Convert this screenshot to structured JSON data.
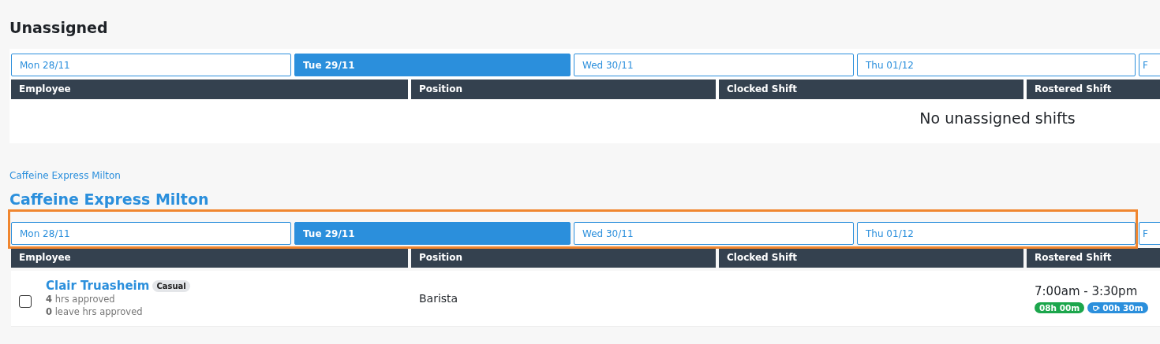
{
  "sections": [
    {
      "kind": "unassigned",
      "title": "Unassigned",
      "highlighted": false,
      "days": [
        {
          "label": "Mon 28/11",
          "selected": false
        },
        {
          "label": "Tue 29/11",
          "selected": true
        },
        {
          "label": "Wed 30/11",
          "selected": false
        },
        {
          "label": "Thu 01/12",
          "selected": false
        },
        {
          "label": "F",
          "selected": false
        }
      ],
      "columns": [
        "Employee",
        "Position",
        "Clocked Shift",
        "Rostered Shift"
      ],
      "empty_message": "No unassigned shifts"
    },
    {
      "kind": "location",
      "breadcrumb": "Caffeine Express Milton",
      "title": "Caffeine Express Milton",
      "highlighted": true,
      "days": [
        {
          "label": "Mon 28/11",
          "selected": false
        },
        {
          "label": "Tue 29/11",
          "selected": true
        },
        {
          "label": "Wed 30/11",
          "selected": false
        },
        {
          "label": "Thu 01/12",
          "selected": false
        },
        {
          "label": "F",
          "selected": false
        }
      ],
      "columns": [
        "Employee",
        "Position",
        "Clocked Shift",
        "Rostered Shift"
      ],
      "rows": [
        {
          "checked": false,
          "name": "Clair Truasheim",
          "badge": "Casual",
          "hours": "**4** hrs approved",
          "leave": "**0** leave hrs approved",
          "position": "Barista",
          "rostered": {
            "time": "7:00am - 3:30pm",
            "duration": "08h 00m",
            "break": "00h 30m"
          }
        }
      ]
    }
  ]
}
